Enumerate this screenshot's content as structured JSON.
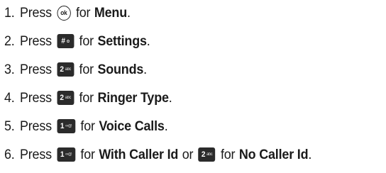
{
  "steps": [
    {
      "number": "1.",
      "press": "Press",
      "key": {
        "icon": "ok-key-icon",
        "label": "ok"
      },
      "for": "for",
      "target": "Menu",
      "end": "."
    },
    {
      "number": "2.",
      "press": "Press",
      "key": {
        "icon": "hash-key-icon",
        "main": "#",
        "sub": "✿"
      },
      "for": "for",
      "target": "Settings",
      "end": "."
    },
    {
      "number": "3.",
      "press": "Press",
      "key": {
        "icon": "two-abc-key-icon",
        "main": "2",
        "sub": "abc"
      },
      "for": "for",
      "target": "Sounds",
      "end": "."
    },
    {
      "number": "4.",
      "press": "Press",
      "key": {
        "icon": "two-abc-key-icon",
        "main": "2",
        "sub": "abc"
      },
      "for": "for",
      "target": "Ringer Type",
      "end": "."
    },
    {
      "number": "5.",
      "press": "Press",
      "key": {
        "icon": "one-voicemail-key-icon",
        "main": "1",
        "sub": "∞@"
      },
      "for": "for",
      "target": "Voice Calls",
      "end": "."
    },
    {
      "number": "6.",
      "press": "Press",
      "key": {
        "icon": "one-voicemail-key-icon",
        "main": "1",
        "sub": "∞@"
      },
      "for": "for",
      "target": "With Caller Id",
      "or": "or",
      "key2": {
        "icon": "two-abc-key-icon",
        "main": "2",
        "sub": "abc"
      },
      "for2": "for",
      "target2": "No Caller Id",
      "end": "."
    }
  ]
}
